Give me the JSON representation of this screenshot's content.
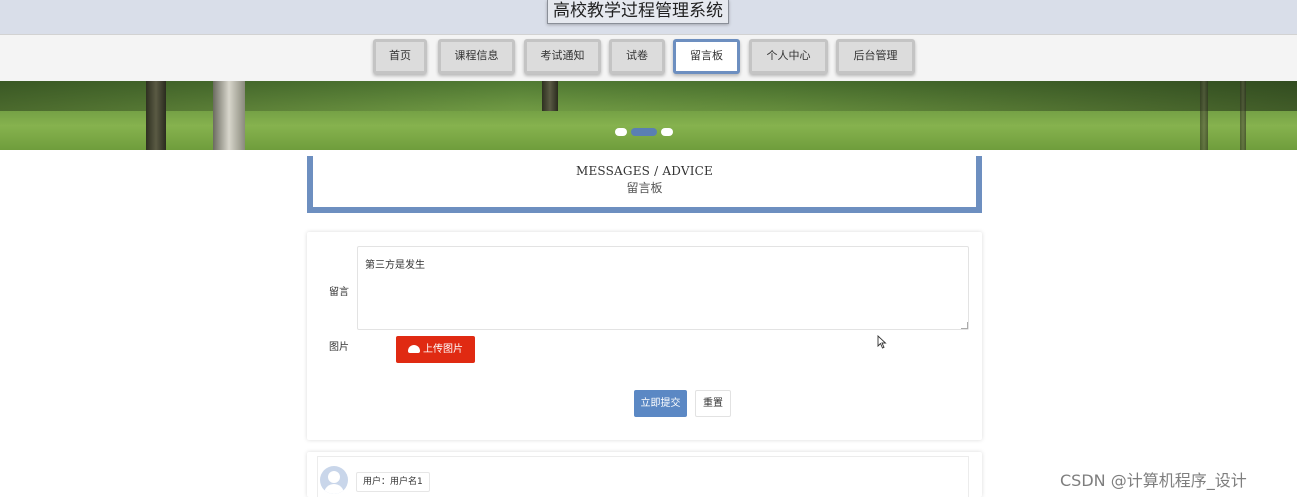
{
  "header": {
    "title": "高校教学过程管理系统"
  },
  "nav": {
    "items": [
      {
        "label": "首页"
      },
      {
        "label": "课程信息"
      },
      {
        "label": "考试通知"
      },
      {
        "label": "试卷"
      },
      {
        "label": "留言板",
        "active": true
      },
      {
        "label": "个人中心"
      },
      {
        "label": "后台管理"
      }
    ]
  },
  "banner": {
    "slides": 3,
    "active_slide": 2
  },
  "section": {
    "title_en": "MESSAGES / ADVICE",
    "title_cn": "留言板"
  },
  "form": {
    "message_label": "留言",
    "message_value": "第三方是发生",
    "image_label": "图片",
    "upload_label": "上传图片",
    "submit_label": "立即提交",
    "reset_label": "重置"
  },
  "comments": [
    {
      "user_text": "用户：用户名1"
    }
  ],
  "watermark": "CSDN @计算机程序_设计",
  "colors": {
    "accent": "#6d8fc0",
    "upload": "#e02a12",
    "submit": "#5b88c4"
  }
}
